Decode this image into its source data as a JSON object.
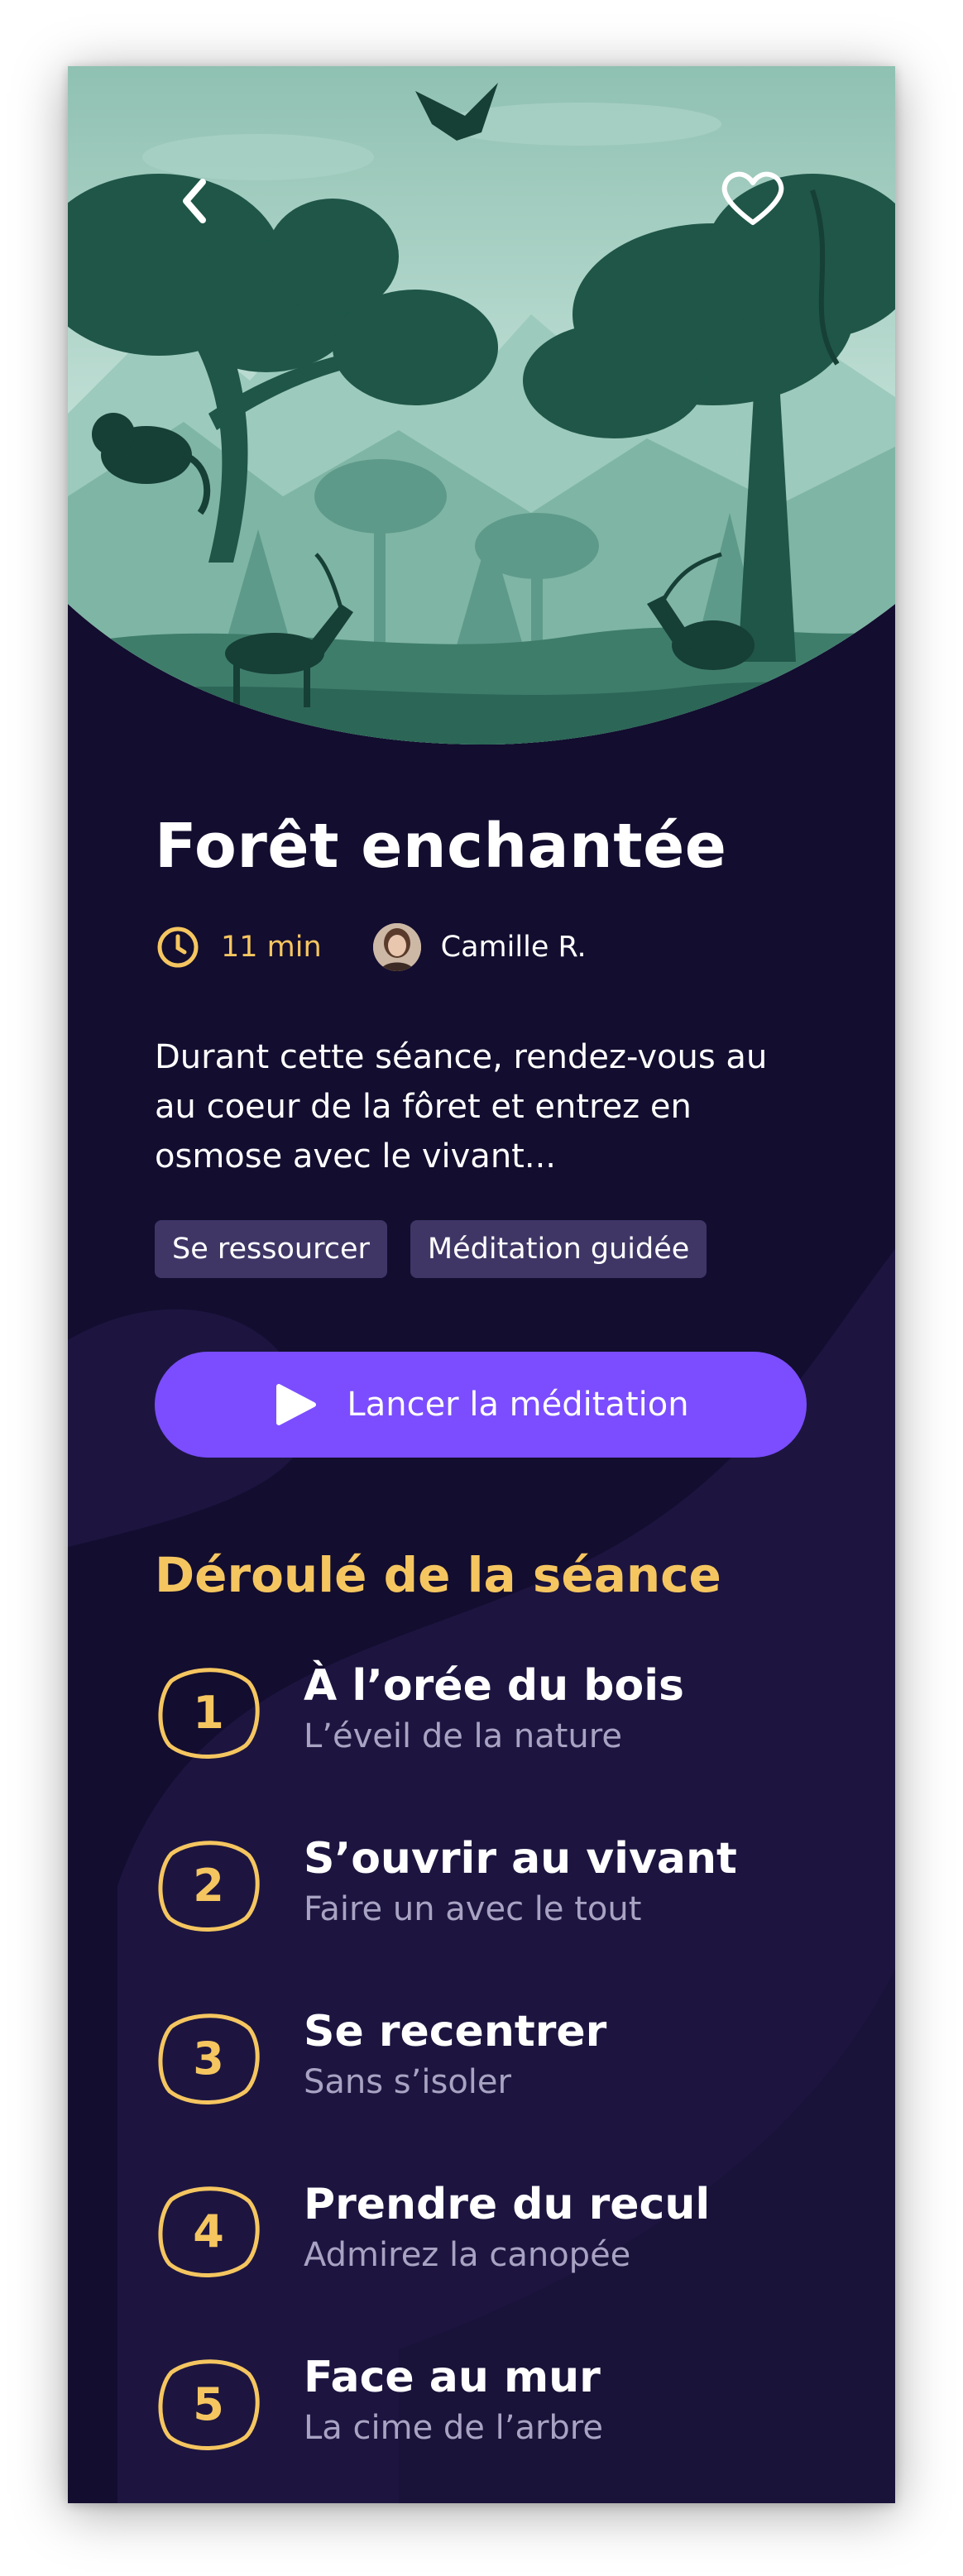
{
  "header": {
    "back_icon": "chevron-left-icon",
    "favorite_icon": "heart-outline-icon"
  },
  "meditation": {
    "title": "Forêt enchantée",
    "duration": "11 min",
    "author": "Camille R.",
    "description": "Durant cette séance, rendez-vous au au coeur de la fôret et entrez en osmose avec le vivant...",
    "tags": [
      "Se ressourcer",
      "Méditation guidée"
    ]
  },
  "cta": {
    "label": "Lancer la méditation",
    "icon": "play-icon"
  },
  "session": {
    "heading": "Déroulé de la séance",
    "steps": [
      {
        "number": "1",
        "title": "À l’orée du bois",
        "subtitle": "L’éveil de la nature"
      },
      {
        "number": "2",
        "title": "S’ouvrir au vivant",
        "subtitle": "Faire un avec le tout"
      },
      {
        "number": "3",
        "title": "Se recentrer",
        "subtitle": "Sans s’isoler"
      },
      {
        "number": "4",
        "title": "Prendre du recul",
        "subtitle": "Admirez la canopée"
      },
      {
        "number": "5",
        "title": "Face au mur",
        "subtitle": "La cime de l’arbre"
      }
    ]
  },
  "colors": {
    "background": "#130d2f",
    "accent": "#f5c660",
    "button": "#7b4dff",
    "tag": "#3f3666",
    "forest_light": "#a6d2c4",
    "forest_dark": "#1b4f43"
  }
}
